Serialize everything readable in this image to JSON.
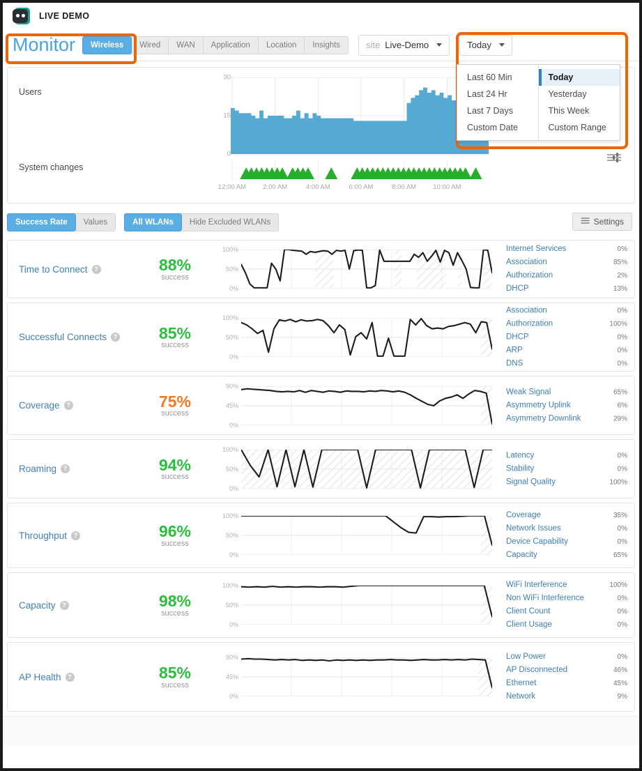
{
  "app": {
    "brand": "LIVE DEMO",
    "logo_icon": "robot-face-icon"
  },
  "nav": {
    "page_title": "Monitor",
    "tabs": [
      {
        "label": "Wireless",
        "active": true
      },
      {
        "label": "Wired",
        "active": false
      },
      {
        "label": "WAN",
        "active": false
      },
      {
        "label": "Application",
        "active": false
      },
      {
        "label": "Location",
        "active": false
      },
      {
        "label": "Insights",
        "active": false
      }
    ],
    "site_selector": {
      "hint": "site",
      "value": "Live-Demo",
      "icon": "chevron-down-icon"
    },
    "date_selector": {
      "value": "Today",
      "icon": "chevron-down-icon"
    }
  },
  "date_dropdown": {
    "left_column": [
      "Last 60 Min",
      "Last 24 Hr",
      "Last 7 Days",
      "Custom Date"
    ],
    "right_column": [
      "Today",
      "Yesterday",
      "This Week",
      "Custom Range"
    ],
    "selected": "Today"
  },
  "overview": {
    "users_label": "Users",
    "system_changes_label": "System changes",
    "filter_icon": "sliders-icon"
  },
  "toolbar": {
    "metric_mode": [
      {
        "label": "Success Rate",
        "active": true
      },
      {
        "label": "Values",
        "active": false
      }
    ],
    "wlan_filter": [
      {
        "label": "All WLANs",
        "active": true
      },
      {
        "label": "Hide Excluded WLANs",
        "active": false
      }
    ],
    "settings_label": "Settings",
    "settings_icon": "sliders-icon"
  },
  "metrics": [
    {
      "name": "Time to Connect",
      "percent": "88%",
      "sub": "success",
      "color": "green",
      "yticks": [
        "100%",
        "50%",
        "0%"
      ],
      "legend": [
        {
          "name": "Internet Services",
          "value": "0%"
        },
        {
          "name": "Association",
          "value": "85%"
        },
        {
          "name": "Authorization",
          "value": "2%"
        },
        {
          "name": "DHCP",
          "value": "13%"
        }
      ]
    },
    {
      "name": "Successful Connects",
      "percent": "85%",
      "sub": "success",
      "color": "green",
      "yticks": [
        "100%",
        "50%",
        "0%"
      ],
      "legend": [
        {
          "name": "Association",
          "value": "0%"
        },
        {
          "name": "Authorization",
          "value": "100%"
        },
        {
          "name": "DHCP",
          "value": "0%"
        },
        {
          "name": "ARP",
          "value": "0%"
        },
        {
          "name": "DNS",
          "value": "0%"
        }
      ]
    },
    {
      "name": "Coverage",
      "percent": "75%",
      "sub": "success",
      "color": "orange",
      "yticks": [
        "90%",
        "45%",
        "0%"
      ],
      "legend": [
        {
          "name": "Weak Signal",
          "value": "65%"
        },
        {
          "name": "Asymmetry Uplink",
          "value": "6%"
        },
        {
          "name": "Asymmetry Downlink",
          "value": "29%"
        }
      ]
    },
    {
      "name": "Roaming",
      "percent": "94%",
      "sub": "success",
      "color": "green",
      "yticks": [
        "100%",
        "50%",
        "0%"
      ],
      "legend": [
        {
          "name": "Latency",
          "value": "0%"
        },
        {
          "name": "Stability",
          "value": "0%"
        },
        {
          "name": "Signal Quality",
          "value": "100%"
        }
      ]
    },
    {
      "name": "Throughput",
      "percent": "96%",
      "sub": "success",
      "color": "green",
      "yticks": [
        "100%",
        "50%",
        "0%"
      ],
      "legend": [
        {
          "name": "Coverage",
          "value": "35%"
        },
        {
          "name": "Network Issues",
          "value": "0%"
        },
        {
          "name": "Device Capability",
          "value": "0%"
        },
        {
          "name": "Capacity",
          "value": "65%"
        }
      ]
    },
    {
      "name": "Capacity",
      "percent": "98%",
      "sub": "success",
      "color": "green",
      "yticks": [
        "100%",
        "50%",
        "0%"
      ],
      "legend": [
        {
          "name": "WiFi Interference",
          "value": "100%"
        },
        {
          "name": "Non WiFi Interference",
          "value": "0%"
        },
        {
          "name": "Client Count",
          "value": "0%"
        },
        {
          "name": "Client Usage",
          "value": "0%"
        }
      ]
    },
    {
      "name": "AP Health",
      "percent": "85%",
      "sub": "success",
      "color": "green",
      "yticks": [
        "90%",
        "45%",
        "0%"
      ],
      "legend": [
        {
          "name": "Low Power",
          "value": "0%"
        },
        {
          "name": "AP Disconnected",
          "value": "46%"
        },
        {
          "name": "Ethernet",
          "value": "45%"
        },
        {
          "name": "Network",
          "value": "9%"
        }
      ]
    }
  ],
  "colors": {
    "accent_blue": "#5aaee4",
    "title_blue": "#4aa3df",
    "link_blue": "#3f7fb5",
    "highlight_orange": "#ec6608",
    "success_green": "#2cbd3f",
    "warn_orange": "#ee7b22",
    "area_blue": "#56a9d3",
    "marker_green": "#27ae2a"
  },
  "chart_data": [
    {
      "type": "area",
      "title": "Users",
      "ylabel": "",
      "xlabel": "",
      "ylim": [
        0,
        30
      ],
      "yticks": [
        0,
        15,
        30
      ],
      "xticks": [
        "12:00 AM",
        "2:00 AM",
        "4:00 AM",
        "6:00 AM",
        "8:00 AM",
        "10:00 AM"
      ],
      "values": [
        18,
        17,
        16,
        16,
        16,
        15,
        14,
        17,
        14,
        15,
        15,
        15,
        15,
        14,
        14,
        15,
        17,
        14,
        16,
        14,
        16,
        15,
        14,
        14,
        14,
        14,
        14,
        14,
        14,
        14,
        13,
        13,
        13,
        13,
        13,
        13,
        13,
        13,
        13,
        13,
        13,
        13,
        13,
        20,
        22,
        23,
        25,
        26,
        24,
        25,
        23,
        24,
        22,
        23,
        21,
        20,
        21,
        21,
        21,
        20,
        20,
        13,
        13
      ]
    },
    {
      "type": "scatter",
      "title": "System changes",
      "marker": "triangle",
      "color": "#27ae2a",
      "x": [
        0.06,
        0.08,
        0.1,
        0.12,
        0.14,
        0.16,
        0.18,
        0.2,
        0.24,
        0.26,
        0.28,
        0.3,
        0.39,
        0.49,
        0.51,
        0.53,
        0.55,
        0.57,
        0.59,
        0.61,
        0.63,
        0.65,
        0.67,
        0.69,
        0.71,
        0.73,
        0.75,
        0.77,
        0.79,
        0.81,
        0.83,
        0.85,
        0.87,
        0.89,
        0.91,
        0.95
      ],
      "y": [
        1,
        1,
        1,
        1,
        1,
        1,
        1,
        1,
        1,
        1,
        1,
        1,
        1,
        1,
        1,
        1,
        1,
        1,
        1,
        1,
        1,
        1,
        1,
        1,
        1,
        1,
        1,
        1,
        1,
        1,
        1,
        1,
        1,
        1,
        1,
        1
      ]
    },
    {
      "type": "line",
      "title": "Time to Connect",
      "ylim": [
        0,
        100
      ],
      "yticks": [
        0,
        50,
        100
      ],
      "values": [
        62,
        40,
        12,
        2,
        2,
        2,
        2,
        65,
        50,
        20,
        100,
        100,
        98,
        97,
        96,
        88,
        95,
        93,
        95,
        97,
        96,
        88,
        98,
        96,
        98,
        50,
        97,
        99,
        98,
        2,
        2,
        8,
        99,
        70,
        70,
        70,
        70,
        70,
        70,
        70,
        88,
        80,
        92,
        70,
        83,
        98,
        68,
        98,
        92,
        60,
        92,
        72,
        50,
        3,
        2,
        2,
        100,
        98,
        40
      ]
    },
    {
      "type": "line",
      "title": "Successful Connects",
      "ylim": [
        0,
        100
      ],
      "yticks": [
        0,
        50,
        100
      ],
      "values": [
        88,
        82,
        72,
        60,
        68,
        12,
        72,
        95,
        92,
        96,
        90,
        95,
        92,
        93,
        96,
        93,
        80,
        62,
        82,
        70,
        5,
        52,
        62,
        46,
        88,
        2,
        2,
        48,
        2,
        2,
        2,
        96,
        82,
        98,
        80,
        72,
        74,
        72,
        78,
        80,
        84,
        88,
        84,
        62,
        90,
        88,
        20
      ]
    },
    {
      "type": "line",
      "title": "Coverage",
      "ylim": [
        0,
        90
      ],
      "yticks": [
        0,
        45,
        90
      ],
      "values": [
        82,
        84,
        83,
        82,
        81,
        80,
        78,
        77,
        78,
        77,
        80,
        76,
        80,
        78,
        76,
        79,
        78,
        76,
        79,
        78,
        78,
        77,
        79,
        78,
        80,
        79,
        77,
        79,
        76,
        70,
        62,
        55,
        48,
        45,
        56,
        62,
        65,
        70,
        62,
        72,
        80,
        78,
        74,
        3
      ]
    },
    {
      "type": "line",
      "title": "Roaming",
      "ylim": [
        0,
        100
      ],
      "yticks": [
        0,
        50,
        100
      ],
      "values": [
        100,
        60,
        30,
        100,
        5,
        100,
        5,
        100,
        4,
        100,
        100,
        100,
        100,
        100,
        2,
        100,
        100,
        100,
        100,
        100,
        2,
        100,
        100,
        100,
        100,
        100,
        3,
        100,
        100
      ]
    },
    {
      "type": "line",
      "title": "Throughput",
      "ylim": [
        0,
        100
      ],
      "yticks": [
        0,
        50,
        100
      ],
      "values": [
        100,
        100,
        100,
        100,
        100,
        100,
        100,
        100,
        100,
        100,
        100,
        100,
        100,
        100,
        100,
        100,
        100,
        100,
        100,
        100,
        85,
        70,
        58,
        56,
        98,
        98,
        97,
        98,
        98,
        99,
        100,
        100,
        100,
        25
      ]
    },
    {
      "type": "line",
      "title": "Capacity",
      "ylim": [
        0,
        100
      ],
      "yticks": [
        0,
        50,
        100
      ],
      "values": [
        97,
        96,
        97,
        96,
        98,
        96,
        97,
        96,
        97,
        97,
        96,
        97,
        97,
        96,
        98,
        100,
        100,
        100,
        100,
        100,
        100,
        100,
        100,
        100,
        100,
        100,
        100,
        100,
        100,
        100,
        100,
        100,
        20
      ]
    },
    {
      "type": "line",
      "title": "AP Health",
      "ylim": [
        0,
        90
      ],
      "yticks": [
        0,
        45,
        90
      ],
      "values": [
        86,
        87,
        86,
        86,
        85,
        84,
        85,
        84,
        85,
        83,
        84,
        83,
        84,
        82,
        84,
        83,
        84,
        83,
        84,
        83,
        84,
        84,
        85,
        84,
        84,
        83,
        84,
        85,
        84,
        84,
        85,
        84,
        85,
        84,
        86,
        85,
        84,
        20
      ]
    }
  ]
}
